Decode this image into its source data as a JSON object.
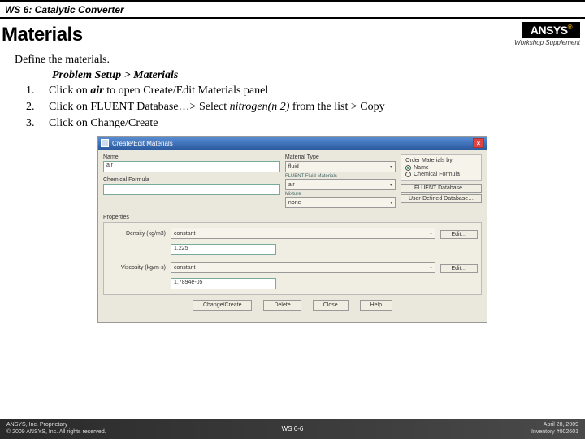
{
  "topbar": {
    "title": "WS 6: Catalytic Converter"
  },
  "header": {
    "title": "Materials",
    "logo": "ANSYS",
    "supplement": "Workshop Supplement"
  },
  "content": {
    "intro": "Define the materials.",
    "path_label": "Problem Setup > Materials",
    "step1_a": "Click on ",
    "step1_b": "air",
    "step1_c": " to open Create/Edit Materials panel",
    "step2_a": "Click on FLUENT Database…> Select ",
    "step2_b": "nitrogen(n 2)",
    "step2_c": " from the list > Copy",
    "step3": "Click on Change/Create"
  },
  "dialog": {
    "title": "Create/Edit Materials",
    "name_label": "Name",
    "name_value": "air",
    "formula_label": "Chemical Formula",
    "formula_value": "",
    "mtype_label": "Material Type",
    "mtype_value": "fluid",
    "fmat_label": "FLUENT Fluid Materials",
    "fmat_value": "air",
    "mix_label": "Mixture",
    "mix_value": "none",
    "order_label": "Order Materials by",
    "order_name": "Name",
    "order_formula": "Chemical Formula",
    "btn_fluent": "FLUENT Database…",
    "btn_user": "User-Defined Database…",
    "props_label": "Properties",
    "density_label": "Density (kg/m3)",
    "viscosity_label": "Viscosity (kg/m-s)",
    "constant": "constant",
    "edit": "Edit…",
    "density_val": "1.225",
    "viscosity_val": "1.7894e-05",
    "btn_change": "Change/Create",
    "btn_delete": "Delete",
    "btn_close": "Close",
    "btn_help": "Help"
  },
  "footer": {
    "prop1": "ANSYS, Inc. Proprietary",
    "prop2": "© 2009 ANSYS, Inc. All rights reserved.",
    "page": "WS 6-6",
    "date": "April 28, 2009",
    "inv": "Inventory #002601"
  }
}
